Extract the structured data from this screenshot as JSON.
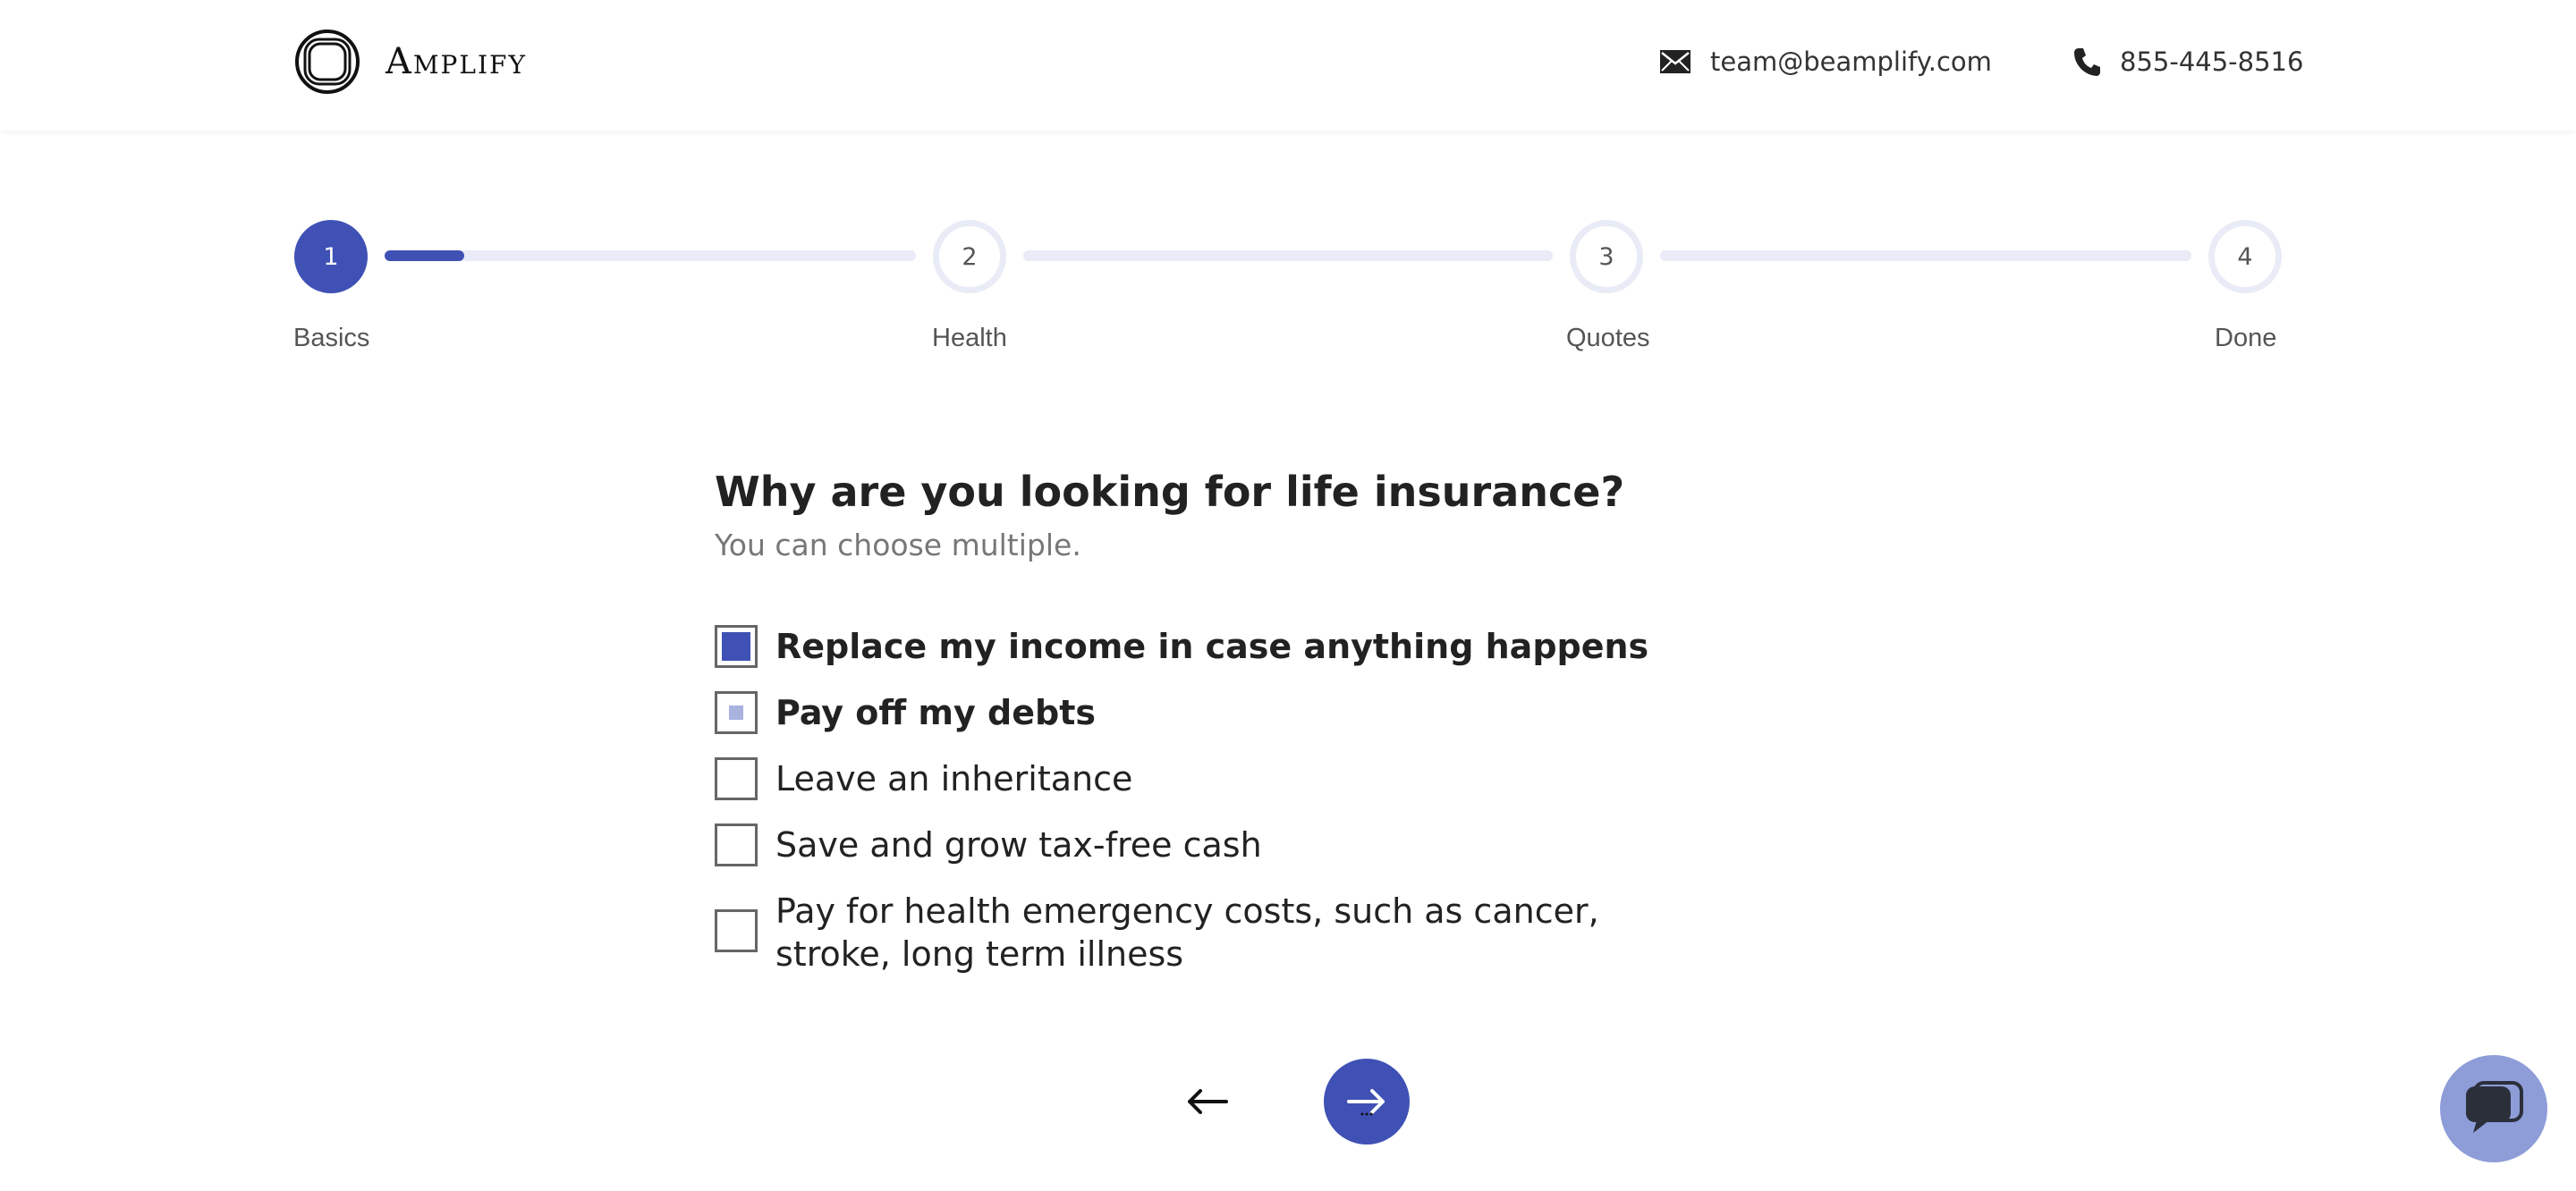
{
  "header": {
    "brand": "Amplify",
    "email": "team@beamplify.com",
    "phone": "855-445-8516"
  },
  "stepper": {
    "steps": [
      {
        "number": "1",
        "label": "Basics"
      },
      {
        "number": "2",
        "label": "Health"
      },
      {
        "number": "3",
        "label": "Quotes"
      },
      {
        "number": "4",
        "label": "Done"
      }
    ],
    "current_step": 1,
    "segment_progress": [
      0.15,
      0,
      0
    ]
  },
  "question": {
    "title": "Why are you looking for life insurance?",
    "hint": "You can choose multiple."
  },
  "options": [
    {
      "label": "Replace my income in case anything happens",
      "state": "checked"
    },
    {
      "label": "Pay off my debts",
      "state": "partial"
    },
    {
      "label": "Leave an inheritance",
      "state": "unchecked"
    },
    {
      "label": "Save and grow tax-free cash",
      "state": "unchecked"
    },
    {
      "label": "Pay for health emergency costs, such as cancer, stroke, long term illness",
      "state": "unchecked"
    }
  ],
  "colors": {
    "accent": "#3f51b5",
    "track": "#e9ecf6",
    "chat": "#8e9dd8"
  },
  "icons": {
    "logo": "amplify-logo-icon",
    "email": "envelope-icon",
    "phone": "phone-icon",
    "back": "arrow-left-icon",
    "next": "arrow-right-icon",
    "chat": "chat-bubble-icon"
  }
}
